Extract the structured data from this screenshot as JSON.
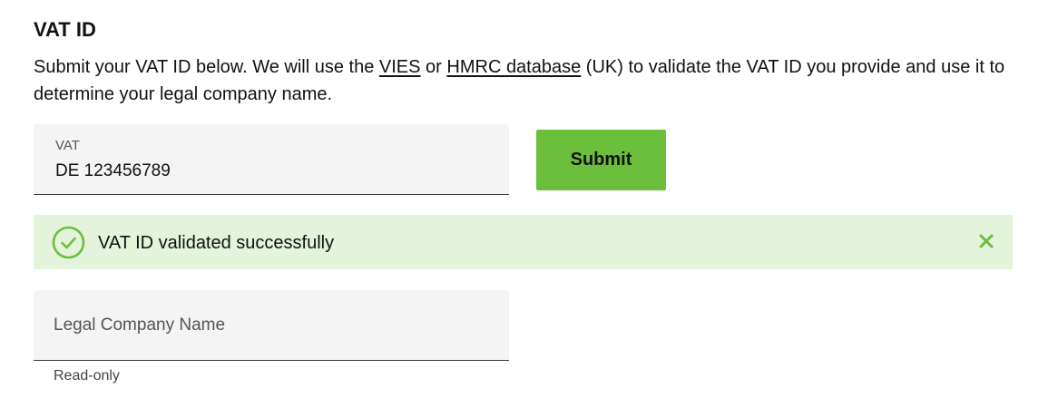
{
  "section": {
    "title": "VAT ID"
  },
  "description": {
    "part1": "Submit your VAT ID below. We will use the ",
    "link_vies": "VIES",
    "part2": " or ",
    "link_hmrc": "HMRC database",
    "part3": " (UK) to validate the VAT ID you provide and use it to determine your legal company name."
  },
  "vat_field": {
    "label": "VAT",
    "value": "DE 123456789"
  },
  "submit_button": {
    "label": "Submit"
  },
  "alert": {
    "message": "VAT ID validated successfully",
    "icon": "check-circle-icon",
    "close_icon": "close-icon"
  },
  "company_field": {
    "placeholder": "Legal Company Name",
    "value": "",
    "helper": "Read-only"
  },
  "colors": {
    "accent": "#6cbf3d",
    "success_bg": "#e4f3dc",
    "field_bg": "#f4f4f4"
  }
}
